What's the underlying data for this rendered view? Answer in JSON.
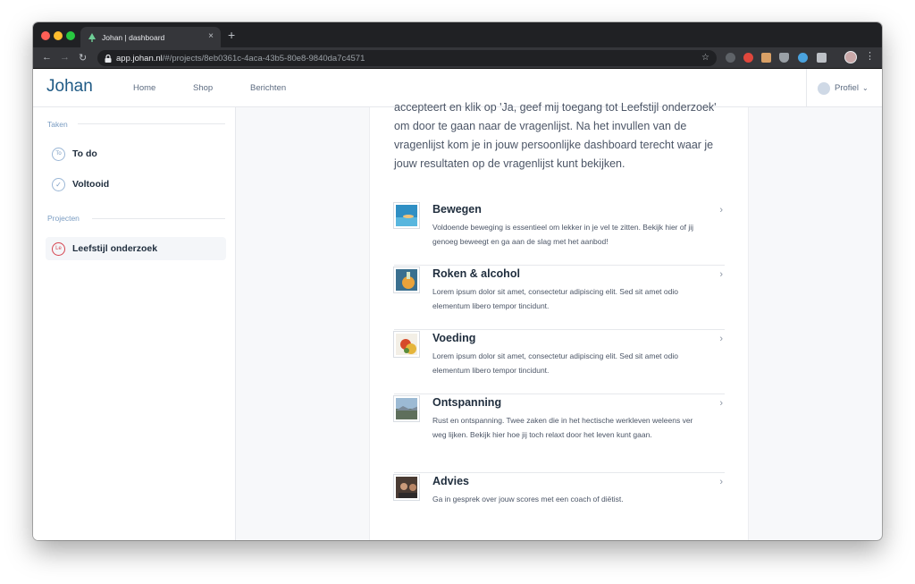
{
  "browser": {
    "tab_title": "Johan | dashboard",
    "tab_close": "×",
    "new_tab": "+",
    "url_host": "app.johan.nl",
    "url_path": "/#/projects/8eb0361c-4aca-43b5-80e8-9840da7c4571",
    "nav_back": "←",
    "nav_forward": "→",
    "nav_reload": "↻",
    "star": "☆",
    "menu": "⋮"
  },
  "header": {
    "logo": "Johan",
    "nav": [
      "Home",
      "Shop",
      "Berichten"
    ],
    "profile_label": "Profiel",
    "profile_chevron": "⌄"
  },
  "sidebar": {
    "taken_title": "Taken",
    "taken_items": [
      {
        "label": "To do",
        "icon_text": "To"
      },
      {
        "label": "Voltooid",
        "icon_text": "✓"
      }
    ],
    "projecten_title": "Projecten",
    "projecten_items": [
      {
        "label": "Leefstijl onderzoek",
        "icon_text": "Le"
      }
    ]
  },
  "main": {
    "intro": "accepteert en klik op 'Ja, geef mij toegang tot Leefstijl onderzoek' om door te gaan naar de vragenlijst. Na het invullen van de vragenlijst kom je in jouw persoonlijke dashboard terecht waar je jouw resultaten op de vragenlijst kunt bekijken.",
    "chevron": "›",
    "items": [
      {
        "title": "Bewegen",
        "desc": "Voldoende beweging is essentieel om lekker in je vel te zitten. Bekijk hier of jij genoeg beweegt en ga aan de slag met het aanbod!"
      },
      {
        "title": "Roken & alcohol",
        "desc": "Lorem ipsum dolor sit amet, consectetur adipiscing elit. Sed sit amet odio elementum libero tempor tincidunt."
      },
      {
        "title": "Voeding",
        "desc": "Lorem ipsum dolor sit amet, consectetur adipiscing elit. Sed sit amet odio elementum libero tempor tincidunt."
      },
      {
        "title": "Ontspanning",
        "desc": "Rust en ontspanning. Twee zaken die in het hectische werkleven weleens ver weg lijken. Bekijk hier hoe jij toch relaxt door het leven kunt gaan."
      },
      {
        "title": "Advies",
        "desc": "Ga in gesprek over jouw scores met een coach of diëtist."
      }
    ]
  },
  "colors": {
    "brand": "#1f5a85",
    "accent_red": "#d64550",
    "section_blue": "#7a9cc2"
  }
}
